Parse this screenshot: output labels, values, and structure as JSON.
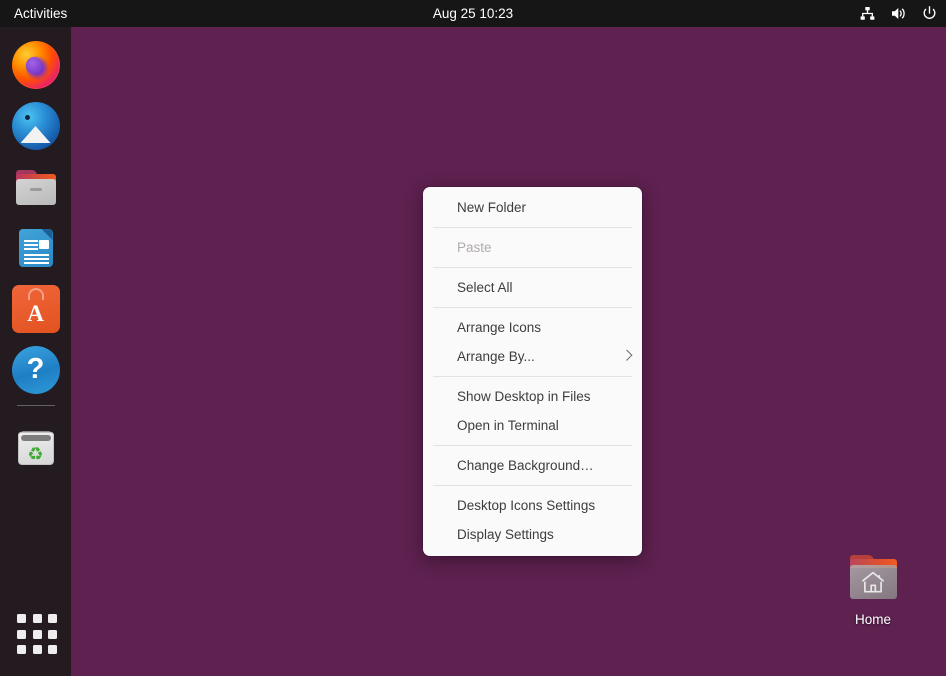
{
  "topbar": {
    "activities_label": "Activities",
    "clock": "Aug 25  10:23",
    "tray": [
      {
        "name": "network-icon",
        "label": "Network"
      },
      {
        "name": "volume-icon",
        "label": "Volume"
      },
      {
        "name": "power-icon",
        "label": "Power"
      }
    ]
  },
  "dock": {
    "items": [
      {
        "name": "dock-item-firefox",
        "label": "Firefox",
        "icon": "firefox-icon"
      },
      {
        "name": "dock-item-thunderbird",
        "label": "Thunderbird Mail",
        "icon": "thunderbird-icon"
      },
      {
        "name": "dock-item-files",
        "label": "Files",
        "icon": "files-folder-icon"
      },
      {
        "name": "dock-item-libreoffice-writer",
        "label": "LibreOffice Writer",
        "icon": "document-icon"
      },
      {
        "name": "dock-item-ubuntu-software",
        "label": "Ubuntu Software",
        "icon": "software-bag-icon"
      },
      {
        "name": "dock-item-help",
        "label": "Help",
        "icon": "question-mark-icon"
      },
      {
        "name": "dock-item-trash",
        "label": "Trash",
        "icon": "trash-icon"
      }
    ],
    "show_applications_label": "Show Applications"
  },
  "desktop": {
    "background_color": "#5e2150",
    "icons": [
      {
        "name": "desktop-icon-home",
        "label": "Home",
        "icon": "home-folder-icon"
      }
    ]
  },
  "context_menu": {
    "items": [
      {
        "label": "New Folder",
        "name": "menu-item-new-folder",
        "disabled": false,
        "submenu": false
      },
      {
        "separator": true
      },
      {
        "label": "Paste",
        "name": "menu-item-paste",
        "disabled": true,
        "submenu": false
      },
      {
        "separator": true
      },
      {
        "label": "Select All",
        "name": "menu-item-select-all",
        "disabled": false,
        "submenu": false
      },
      {
        "separator": true
      },
      {
        "label": "Arrange Icons",
        "name": "menu-item-arrange-icons",
        "disabled": false,
        "submenu": false
      },
      {
        "label": "Arrange By...",
        "name": "menu-item-arrange-by",
        "disabled": false,
        "submenu": true
      },
      {
        "separator": true
      },
      {
        "label": "Show Desktop in Files",
        "name": "menu-item-show-desktop-in-files",
        "disabled": false,
        "submenu": false
      },
      {
        "label": "Open in Terminal",
        "name": "menu-item-open-in-terminal",
        "disabled": false,
        "submenu": false
      },
      {
        "separator": true
      },
      {
        "label": "Change Background…",
        "name": "menu-item-change-background",
        "disabled": false,
        "submenu": false
      },
      {
        "separator": true
      },
      {
        "label": "Desktop Icons Settings",
        "name": "menu-item-desktop-icons-settings",
        "disabled": false,
        "submenu": false
      },
      {
        "label": "Display Settings",
        "name": "menu-item-display-settings",
        "disabled": false,
        "submenu": false
      }
    ]
  }
}
